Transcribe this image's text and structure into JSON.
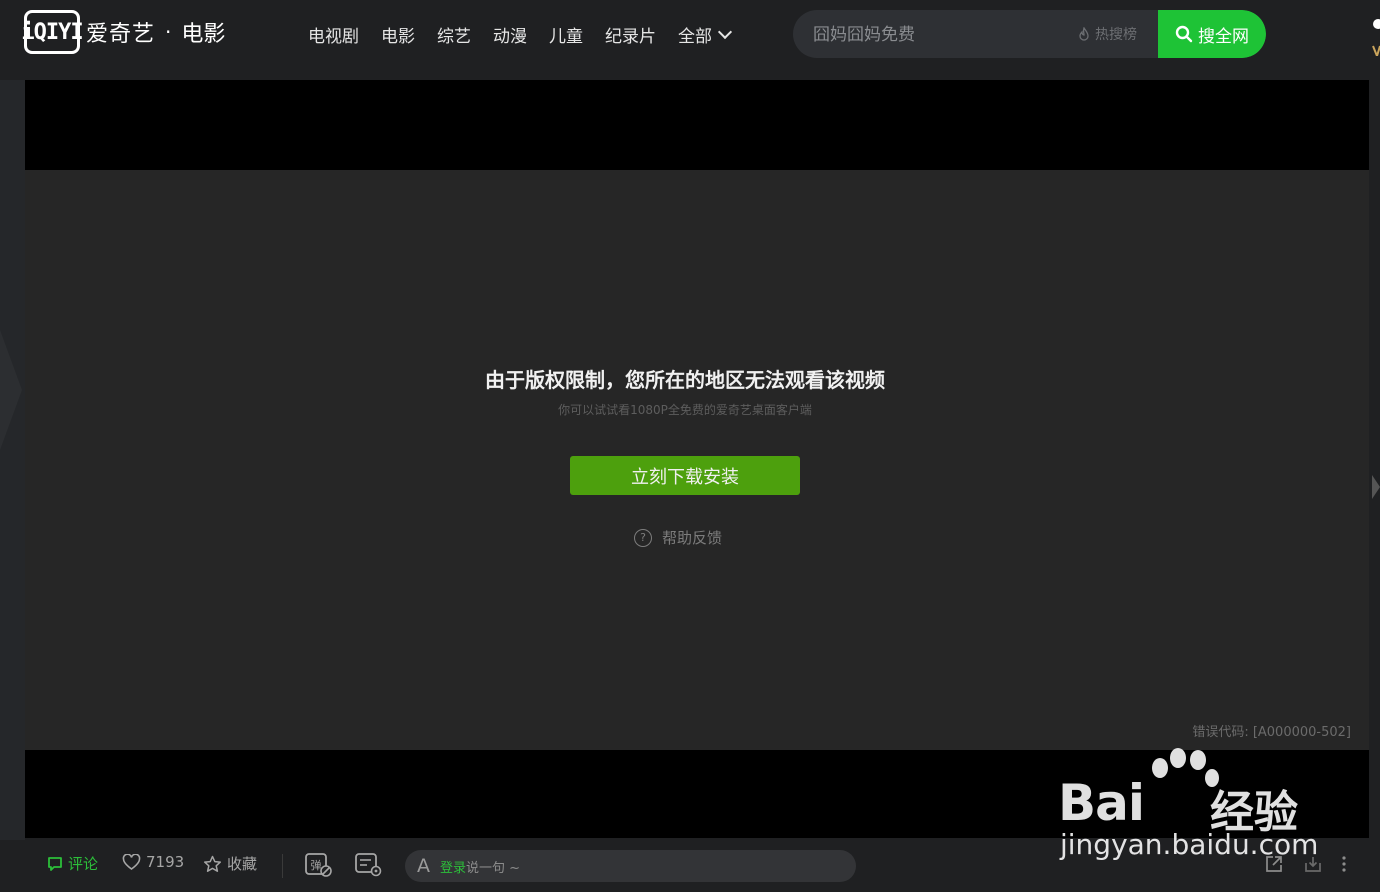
{
  "header": {
    "logo_mark": "iQIYI",
    "logo_text": "爱奇艺",
    "logo_dot": "·",
    "channel": "电影",
    "nav": [
      "电视剧",
      "电影",
      "综艺",
      "动漫",
      "儿童",
      "纪录片"
    ],
    "nav_all": "全部",
    "search": {
      "placeholder": "囧妈囧妈免费",
      "hot_label": "热搜榜",
      "button_label": "搜全网"
    }
  },
  "player": {
    "title": "由于版权限制，您所在的地区无法观看该视频",
    "subtitle": "你可以试试看1080P全免费的爱奇艺桌面客户端",
    "download_button": "立刻下载安装",
    "help_label": "帮助反馈",
    "help_icon_glyph": "?",
    "error_code": "错误代码: [A000000-502]"
  },
  "toolbar": {
    "comment_label": "评论",
    "like_count": "7193",
    "fav_label": "收藏",
    "danmu_icon_text": "弹",
    "danmu_input": {
      "icon_letter": "A",
      "login_link": "登录",
      "prompt": "说一句 ~"
    }
  },
  "watermark": {
    "brand": "Bai",
    "brand_cn": "经验",
    "url": "jingyan.baidu.com"
  },
  "colors": {
    "accent_green": "#1ec336",
    "download_green": "#4da00d",
    "background": "#1f2022"
  }
}
